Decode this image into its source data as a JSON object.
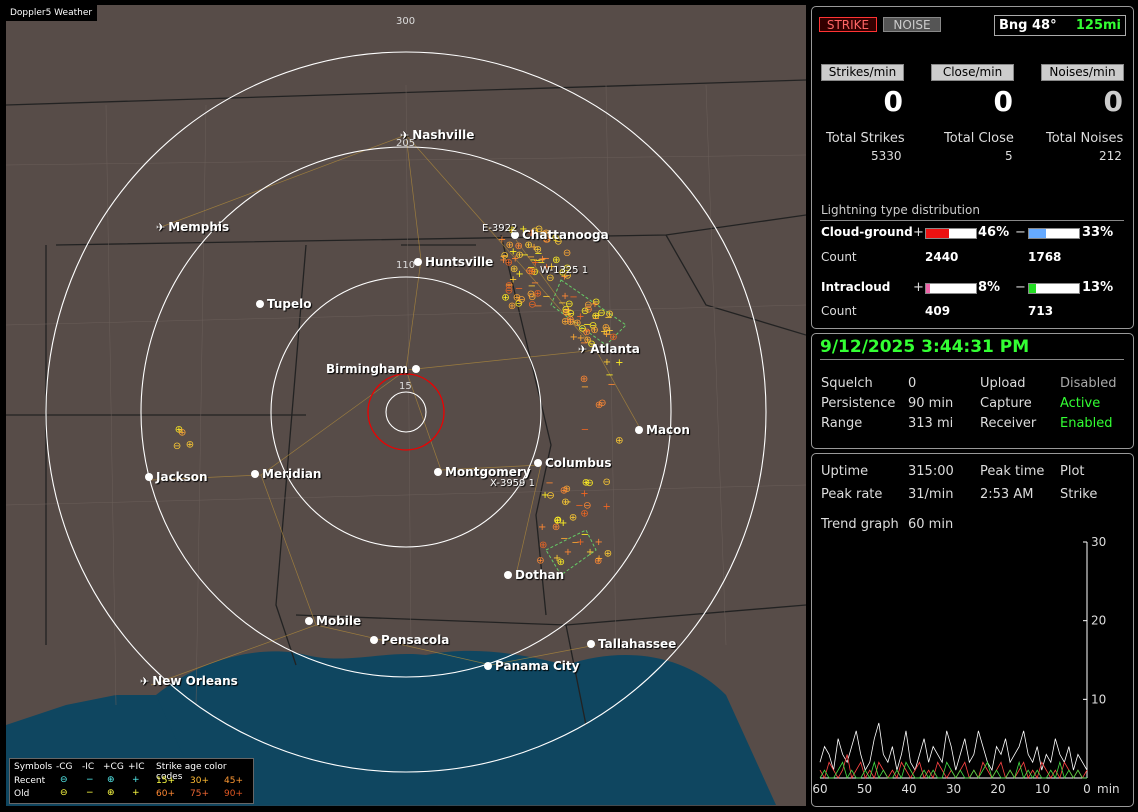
{
  "app": {
    "title": "Doppler5 Weather"
  },
  "rings": {
    "r300": "300",
    "r205": "205",
    "r110": "110",
    "r15": "15"
  },
  "cities": [
    {
      "name": "Nashville",
      "airport": true
    },
    {
      "name": "Memphis",
      "airport": true
    },
    {
      "name": "Chattanooga",
      "airport": false
    },
    {
      "name": "Huntsville",
      "airport": false
    },
    {
      "name": "Tupelo",
      "airport": false
    },
    {
      "name": "Atlanta",
      "airport": true
    },
    {
      "name": "Birmingham",
      "airport": false
    },
    {
      "name": "Macon",
      "airport": false
    },
    {
      "name": "Jackson",
      "airport": false
    },
    {
      "name": "Meridian",
      "airport": false
    },
    {
      "name": "Montgomery",
      "airport": false
    },
    {
      "name": "Columbus",
      "airport": false
    },
    {
      "name": "Dothan",
      "airport": false
    },
    {
      "name": "Mobile",
      "airport": false
    },
    {
      "name": "Pensacola",
      "airport": false
    },
    {
      "name": "Tallahassee",
      "airport": false
    },
    {
      "name": "Panama City",
      "airport": false
    },
    {
      "name": "New Orleans",
      "airport": true
    }
  ],
  "storm_tags": {
    "e": "E-3922 ",
    "w": "W-1325 1",
    "x": "X-3959 1"
  },
  "legend": {
    "symbols": "Symbols",
    "cg_minus": "-CG",
    "ic_minus": "-IC",
    "cg_plus": "+CG",
    "ic_plus": "+IC",
    "age": "Strike age color codes",
    "recent": "Recent",
    "old": "Old",
    "a15": "15+",
    "a30": "30+",
    "a45": "45+",
    "a60": "60+",
    "a75": "75+",
    "a90": "90+"
  },
  "mode": {
    "strike": "STRIKE",
    "noise": "NOISE"
  },
  "bearing": {
    "label": "Bng 48°",
    "range": "125mi"
  },
  "rates": {
    "strikes_hdr": "Strikes/min",
    "close_hdr": "Close/min",
    "noises_hdr": "Noises/min",
    "strikes": "0",
    "close": "0",
    "noises": "0"
  },
  "totals": {
    "strikes_label": "Total Strikes",
    "close_label": "Total Close",
    "noises_label": "Total Noises",
    "strikes": "5330",
    "close": "5",
    "noises": "212"
  },
  "distribution": {
    "title": "Lightning type distribution",
    "cg_label": "Cloud-ground",
    "ic_label": "Intracloud",
    "count_label": "Count",
    "plus": "+",
    "minus": "−",
    "cg_plus_pct": "46%",
    "cg_minus_pct": "33%",
    "cg_plus_count": "2440",
    "cg_minus_count": "1768",
    "ic_plus_pct": "8%",
    "ic_minus_pct": "13%",
    "ic_plus_count": "409",
    "ic_minus_count": "713",
    "cg_plus_frac": 0.46,
    "cg_minus_frac": 0.33,
    "ic_plus_frac": 0.08,
    "ic_minus_frac": 0.13
  },
  "status": {
    "datetime": "9/12/2025 3:44:31 PM",
    "squelch_label": "Squelch",
    "squelch": "0",
    "persistence_label": "Persistence",
    "persistence": "90 min",
    "range_label": "Range",
    "range": "313 mi",
    "upload_label": "Upload",
    "upload": "Disabled",
    "capture_label": "Capture",
    "capture": "Active",
    "receiver_label": "Receiver",
    "receiver": "Enabled"
  },
  "stats": {
    "uptime_label": "Uptime",
    "uptime": "315:00",
    "peak_time_label": "Peak time",
    "plot_label": "Plot",
    "peak_rate_label": "Peak rate",
    "peak_rate": "31/min",
    "peak_time": "2:53 AM",
    "plot": "Strike",
    "trend_label": "Trend graph",
    "trend": "60 min"
  },
  "chart_data": {
    "type": "line",
    "xlabel": "min",
    "x_ticks": [
      "60",
      "50",
      "40",
      "30",
      "20",
      "10",
      "0"
    ],
    "y_ticks": [
      "30",
      "20",
      "10"
    ],
    "ylim": [
      0,
      30
    ],
    "xlim": [
      60,
      0
    ],
    "series": [
      {
        "values": [
          2,
          4,
          3,
          1,
          5,
          3,
          2,
          4,
          6,
          3,
          1,
          2,
          5,
          7,
          3,
          2,
          4,
          1,
          3,
          6,
          2,
          1,
          3,
          5,
          2,
          4,
          3,
          2,
          6,
          4,
          1,
          3,
          5,
          2,
          3,
          6,
          4,
          2,
          1,
          4,
          3,
          5,
          2,
          3,
          4,
          6,
          3,
          2,
          4,
          1,
          3,
          2,
          5,
          3,
          2,
          4,
          1,
          3,
          2,
          1
        ]
      },
      {
        "values": [
          1,
          0,
          2,
          1,
          0,
          1,
          3,
          0,
          1,
          2,
          0,
          1,
          0,
          2,
          1,
          0,
          1,
          0,
          2,
          1,
          0,
          1,
          2,
          0,
          1,
          0,
          2,
          1,
          0,
          1,
          0,
          1,
          2,
          0,
          1,
          0,
          2,
          1,
          0,
          1,
          2,
          0,
          1,
          0,
          1,
          2,
          0,
          1,
          0,
          2,
          1,
          0,
          1,
          0,
          2,
          1,
          0,
          1,
          0,
          1
        ]
      },
      {
        "values": [
          0,
          1,
          0,
          0,
          1,
          2,
          0,
          1,
          0,
          0,
          1,
          0,
          2,
          0,
          1,
          0,
          0,
          1,
          0,
          2,
          1,
          0,
          0,
          1,
          0,
          1,
          0,
          0,
          2,
          1,
          0,
          1,
          0,
          0,
          1,
          0,
          1,
          2,
          0,
          1,
          0,
          0,
          1,
          0,
          2,
          0,
          1,
          0,
          1,
          0,
          0,
          1,
          0,
          2,
          0,
          1,
          0,
          1,
          0,
          0
        ]
      }
    ]
  }
}
